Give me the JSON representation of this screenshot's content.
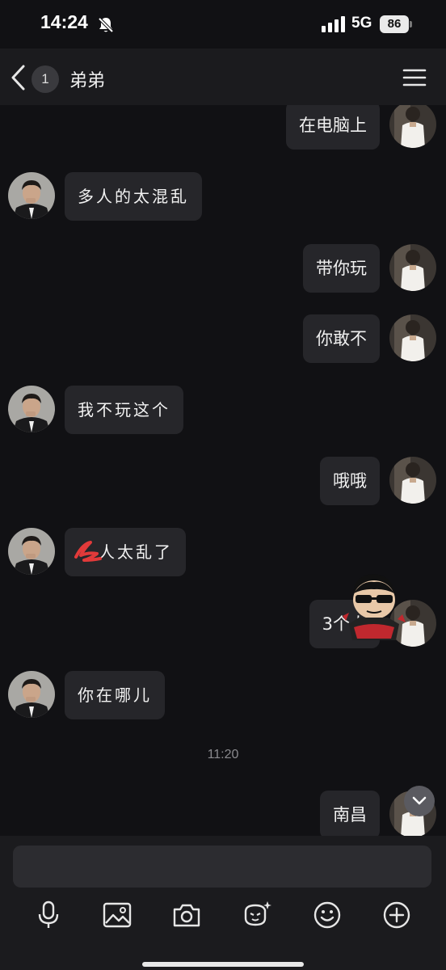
{
  "status_bar": {
    "time": "14:24",
    "network": "5G",
    "battery": "86"
  },
  "header": {
    "unread_count": "1",
    "title": "弟弟"
  },
  "messages": [
    {
      "side": "sent",
      "text": "在电脑上",
      "style": "normal"
    },
    {
      "side": "received",
      "text": "多人的太混乱",
      "style": "handwritten"
    },
    {
      "side": "sent",
      "text": "带你玩",
      "style": "normal"
    },
    {
      "side": "sent",
      "text": "你敢不",
      "style": "normal"
    },
    {
      "side": "received",
      "text": "我不玩这个",
      "style": "handwritten"
    },
    {
      "side": "sent",
      "text": "哦哦",
      "style": "normal"
    },
    {
      "side": "received",
      "text": "人太乱了",
      "style": "handwritten"
    },
    {
      "side": "sent",
      "text": "3个人",
      "style": "normal"
    },
    {
      "side": "received",
      "text": "你在哪儿",
      "style": "handwritten"
    },
    {
      "side": "sent",
      "text": "南昌",
      "style": "normal"
    }
  ],
  "time_separator": "11:20",
  "input": {
    "placeholder": ""
  },
  "toolbar": {
    "icons": [
      "microphone-icon",
      "image-icon",
      "camera-icon",
      "ai-sparkle-icon",
      "emoji-icon",
      "plus-icon"
    ]
  },
  "colors": {
    "background": "#111114",
    "bubble": "#26262a",
    "bar": "#1b1b1e"
  }
}
